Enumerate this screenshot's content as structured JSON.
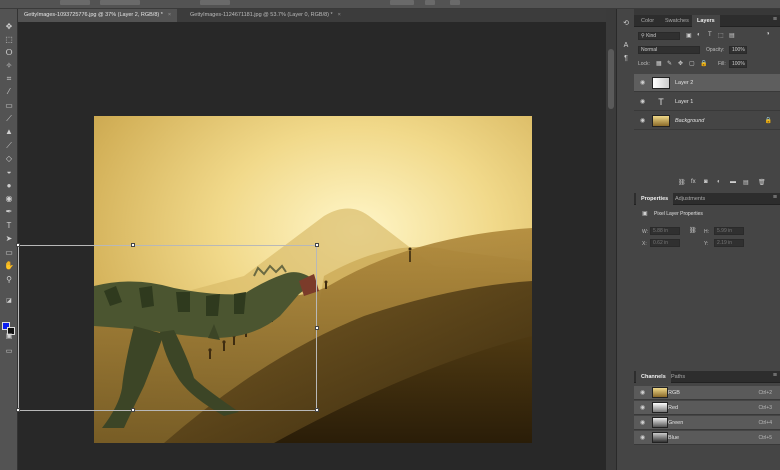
{
  "document_tabs": [
    {
      "label": "GettyImages-1093725776.jpg @ 37% (Layer 2, RGB/8) *",
      "close": "×",
      "active": true
    },
    {
      "label": "GettyImages-1124671181.jpg @ 53.7% (Layer 0, RGB/8) *",
      "close": "×",
      "active": false
    }
  ],
  "tools": [
    "move-icon",
    "marquee-icon",
    "lasso-icon",
    "magic-wand-icon",
    "crop-icon",
    "eyedropper-icon",
    "healing-brush-icon",
    "brush-icon",
    "clone-stamp-icon",
    "history-brush-icon",
    "eraser-icon",
    "paint-bucket-icon",
    "blur-icon",
    "dodge-icon",
    "pen-icon",
    "type-icon",
    "path-selection-icon",
    "rectangle-icon",
    "hand-icon",
    "zoom-icon"
  ],
  "colors": {
    "foreground": "#0a1cf0",
    "background": "#111111",
    "selection": "#5e5e5e"
  },
  "layers_panel": {
    "tabs": [
      "Color",
      "Swatches",
      "Layers"
    ],
    "active_tab": "Layers",
    "filter_kind": "Kind",
    "blend_mode": "Normal",
    "opacity_label": "Opacity:",
    "opacity_value": "100%",
    "lock_label": "Lock:",
    "fill_label": "Fill:",
    "fill_value": "100%",
    "layers": [
      {
        "name": "Layer 2",
        "selected": true,
        "type": "image"
      },
      {
        "name": "Layer 1",
        "selected": false,
        "type": "text"
      },
      {
        "name": "Background",
        "selected": false,
        "type": "background",
        "locked": true
      }
    ],
    "footer_icons": [
      "link-icon",
      "fx",
      "mask-icon",
      "adjustment-icon",
      "folder-icon",
      "new-layer-icon",
      "trash-icon"
    ]
  },
  "properties_panel": {
    "tabs": [
      "Properties",
      "Adjustments"
    ],
    "active_tab": "Properties",
    "title": "Pixel Layer Properties",
    "fields": [
      {
        "label": "W:",
        "value": "5.88 in"
      },
      {
        "label": "X:",
        "value": "0.62 in"
      },
      {
        "label": "H:",
        "value": "5.99 in"
      },
      {
        "label": "Y:",
        "value": "2.19 in"
      }
    ]
  },
  "channels_panel": {
    "tabs": [
      "Channels",
      "Paths"
    ],
    "active_tab": "Channels",
    "channels": [
      {
        "name": "RGB",
        "shortcut": "Ctrl+2"
      },
      {
        "name": "Red",
        "shortcut": "Ctrl+3"
      },
      {
        "name": "Green",
        "shortcut": "Ctrl+4"
      },
      {
        "name": "Blue",
        "shortcut": "Ctrl+5"
      }
    ]
  }
}
